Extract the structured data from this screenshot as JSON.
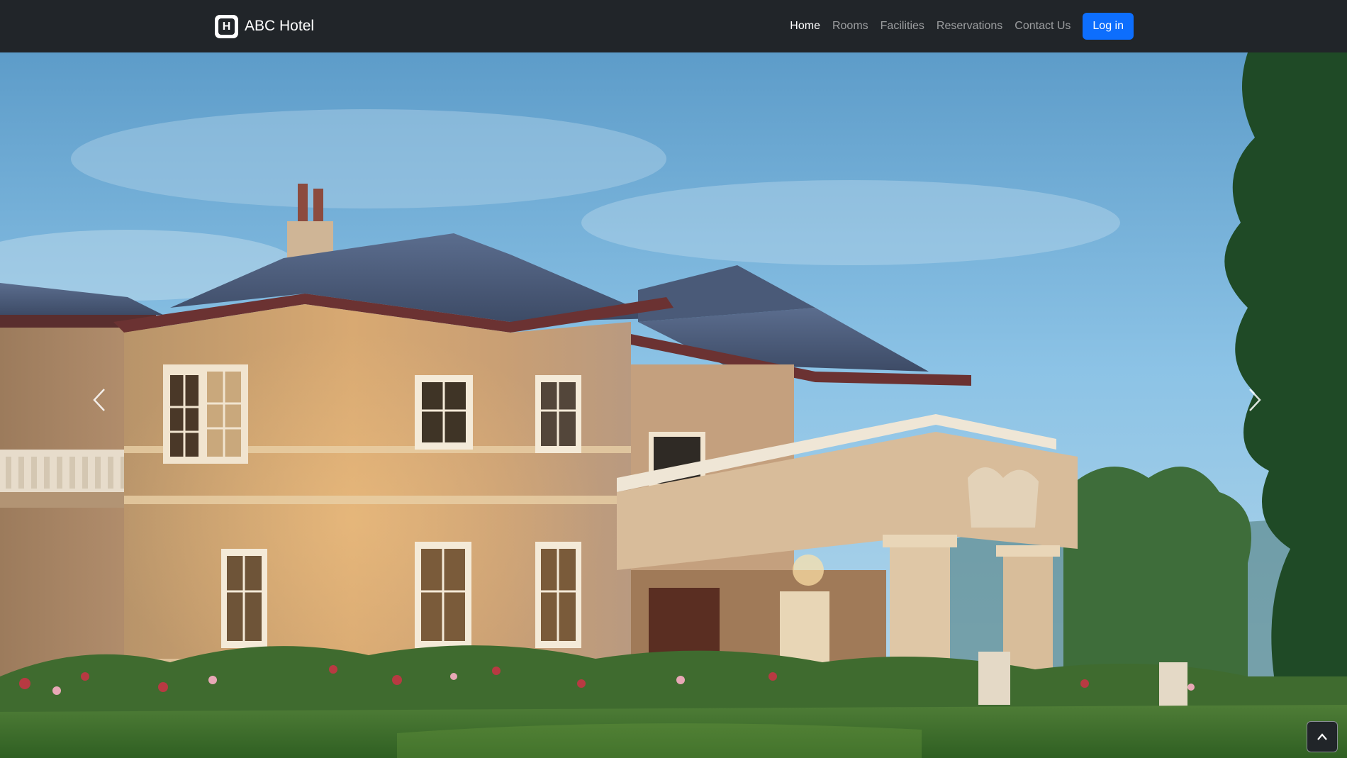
{
  "navbar": {
    "brand_icon_letter": "H",
    "brand_name": "ABC Hotel",
    "links": [
      {
        "label": "Home",
        "active": true
      },
      {
        "label": "Rooms",
        "active": false
      },
      {
        "label": "Facilities",
        "active": false
      },
      {
        "label": "Reservations",
        "active": false
      },
      {
        "label": "Contact Us",
        "active": false
      }
    ],
    "login_label": "Log in",
    "accent_color": "#0d6efd",
    "background_color": "#212529"
  },
  "hero": {
    "image_subject": "hotel-building-photo",
    "prev_icon": "chevron-left-icon",
    "next_icon": "chevron-right-icon"
  },
  "back_to_top": {
    "icon": "chevron-up-icon"
  }
}
